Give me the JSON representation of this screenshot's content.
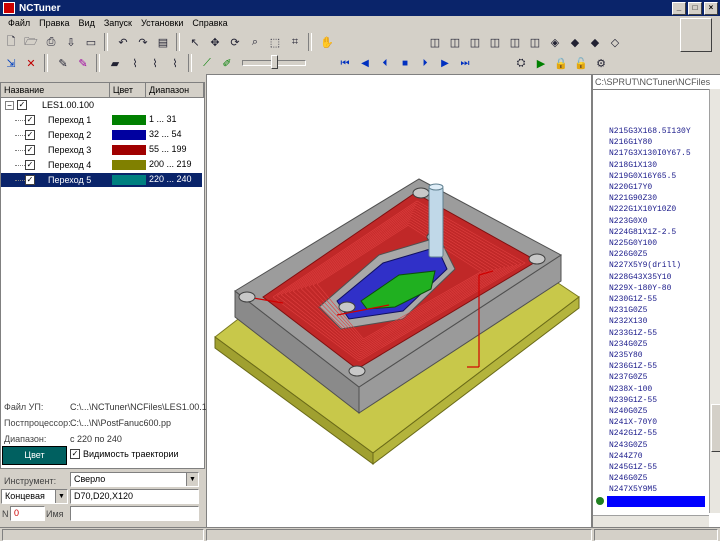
{
  "window": {
    "title": "NCTuner"
  },
  "menu": [
    "Файл",
    "Правка",
    "Вид",
    "Запуск",
    "Установки",
    "Справка"
  ],
  "left_panel": {
    "columns": [
      "Название",
      "Цвет",
      "Диапазон"
    ],
    "root": "LES1.00.100",
    "rows": [
      {
        "label": "Переход 1",
        "color": "#008000",
        "range": "1 ... 31"
      },
      {
        "label": "Переход 2",
        "color": "#0000a0",
        "range": "32 ... 54"
      },
      {
        "label": "Переход 3",
        "color": "#a00000",
        "range": "55 ... 199"
      },
      {
        "label": "Переход 4",
        "color": "#808000",
        "range": "200 ... 219"
      },
      {
        "label": "Переход 5",
        "color": "#008080",
        "range": "220 ... 240"
      }
    ],
    "file_label": "Файл УП:",
    "file_value": "C:\\...\\NCTuner\\NCFiles\\LES1.00.100",
    "post_label": "Постпроцессор:",
    "post_value": "C:\\...\\N\\PostFanuc600.pp",
    "range_label": "Диапазон:",
    "range_value": "с 220 по 240",
    "color_button": "Цвет",
    "visibility_label": "Видимость траектории",
    "tool_label": "Инструмент:",
    "tool_value": "Сверло",
    "mode_value": "Концевая",
    "coords_value": "D70,D20,X120",
    "number_label": "N",
    "number_value": "0",
    "name_label": "Имя"
  },
  "right_panel": {
    "path": "C:\\SPRUT\\NCTuner\\NCFiles",
    "lines": [
      "N215G3X168.5I130Y",
      "N216G1Y80",
      "N217G3X130I0Y67.5",
      "N218G1X130",
      "N219G0X16Y65.5",
      "N220G17Y0",
      "N221G90Z30",
      "N222G1X10Y10Z0",
      "N223G0X0",
      "N224G81X1Z-2.5",
      "N225G0Y100",
      "N226G0Z5",
      "N227X5Y9(drill)",
      "N228G43X35Y10",
      "N229X-180Y-80",
      "N230G1Z-55",
      "N231G0Z5",
      "N232X130",
      "N233G1Z-55",
      "N234G0Z5",
      "N235Y80",
      "N236G1Z-55",
      "N237G0Z5",
      "N238X-100",
      "N239G1Z-55",
      "N240G0Z5",
      "N241X-70Y0",
      "N242G1Z-55",
      "N243G0Z5",
      "N244Z70",
      "N245G1Z-55",
      "N246G0Z5",
      "N247X5Y9M5",
      "N"
    ]
  },
  "scene": {
    "colors": {
      "base": "#c8c84a",
      "body": "#9c9c9c",
      "cut": "#c02828",
      "pocket_blue": "#3030c8",
      "pocket_green": "#20b020",
      "traj": "#d00000",
      "tool": "#c0d8e8"
    }
  }
}
